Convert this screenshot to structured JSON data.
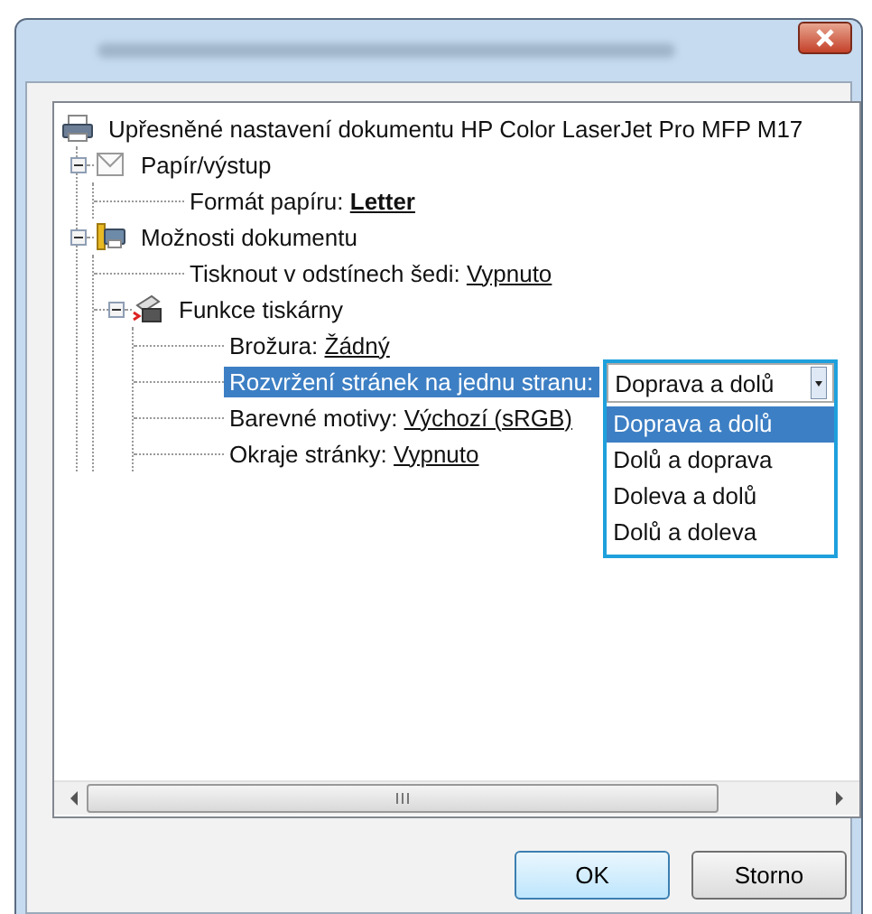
{
  "tree": [
    {
      "kind": "group",
      "label": "Upřesněné nastavení dokumentu HP Color LaserJet Pro MFP M17",
      "selected": false,
      "children": [
        {
          "kind": "group",
          "label": "Papír/výstup",
          "expanded": true,
          "selected": false,
          "children": [
            {
              "kind": "setting",
              "label": "Formát papíru:",
              "value": "Letter",
              "value_bold": true,
              "selected": false
            }
          ]
        },
        {
          "kind": "group",
          "label": "Možnosti dokumentu",
          "expanded": true,
          "selected": false,
          "children": [
            {
              "kind": "setting",
              "label": "Tisknout v odstínech šedi:",
              "value": "Vypnuto",
              "value_bold": false,
              "selected": false
            },
            {
              "kind": "group",
              "label": "Funkce tiskárny",
              "expanded": true,
              "selected": false,
              "children": [
                {
                  "kind": "setting",
                  "label": "Brožura:",
                  "value": "Žádný",
                  "value_bold": false,
                  "selected": false
                },
                {
                  "kind": "setting",
                  "label": "Rozvržení stránek na jednu stranu:",
                  "selected": true,
                  "dropdown": {
                    "value": "Doprava a dolů",
                    "open": true,
                    "options": [
                      {
                        "label": "Doprava a dolů",
                        "selected": true
                      },
                      {
                        "label": "Dolů a doprava",
                        "selected": false
                      },
                      {
                        "label": "Doleva a dolů",
                        "selected": false
                      },
                      {
                        "label": "Dolů a doleva",
                        "selected": false
                      }
                    ]
                  }
                },
                {
                  "kind": "setting",
                  "label": "Barevné motivy:",
                  "value": "Výchozí (sRGB)",
                  "value_bold": false,
                  "selected": false
                },
                {
                  "kind": "setting",
                  "label": "Okraje stránky:",
                  "value": "Vypnuto",
                  "value_bold": false,
                  "selected": false
                }
              ]
            }
          ]
        }
      ]
    }
  ],
  "buttons": [
    {
      "label": "OK",
      "default": true
    },
    {
      "label": "Storno",
      "default": false
    }
  ]
}
